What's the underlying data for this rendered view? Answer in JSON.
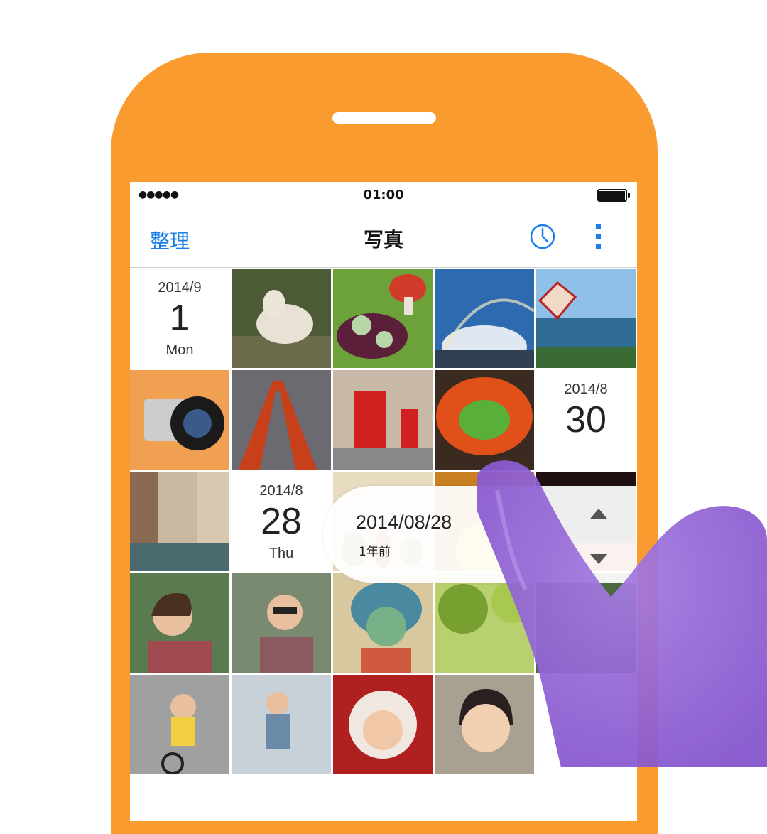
{
  "colors": {
    "phone_body": "#f99b2e",
    "accent": "#1a7fe8",
    "hand": "#9a6ad8"
  },
  "status_bar": {
    "signal": "●●●●●",
    "time": "01:00",
    "battery_icon": "battery-full-icon"
  },
  "nav": {
    "left_button": "整理",
    "title": "写真",
    "right_icons": [
      "clock-icon",
      "more-vertical-icon"
    ]
  },
  "grid": {
    "date_headers": [
      {
        "year_month": "2014/9",
        "day": "1",
        "weekday": "Mon"
      },
      {
        "year_month": "2014/8",
        "day": "30",
        "weekday": ""
      },
      {
        "year_month": "2014/8",
        "day": "28",
        "weekday": "Thu"
      }
    ],
    "photos": [
      "goat",
      "mushroom-sculpture",
      "rainbow-sky",
      "danger-sign-coast",
      "vintage-camera",
      "tokyo-tower",
      "red-mailbox",
      "succulent-jar",
      "venice-canal",
      "glass-vases",
      "sunset-bowl",
      "sunset-lights",
      "woman-smiling",
      "woman-sunglasses",
      "child-frog-hat",
      "green-trees",
      "forest-path",
      "girl-bicycle",
      "child-playground",
      "baby-bear-hood",
      "laughing-toddler"
    ]
  },
  "scrubber": {
    "date": "2014/08/28",
    "relative": "1年前",
    "up_icon": "arrow-up-icon",
    "down_icon": "arrow-down-icon"
  }
}
